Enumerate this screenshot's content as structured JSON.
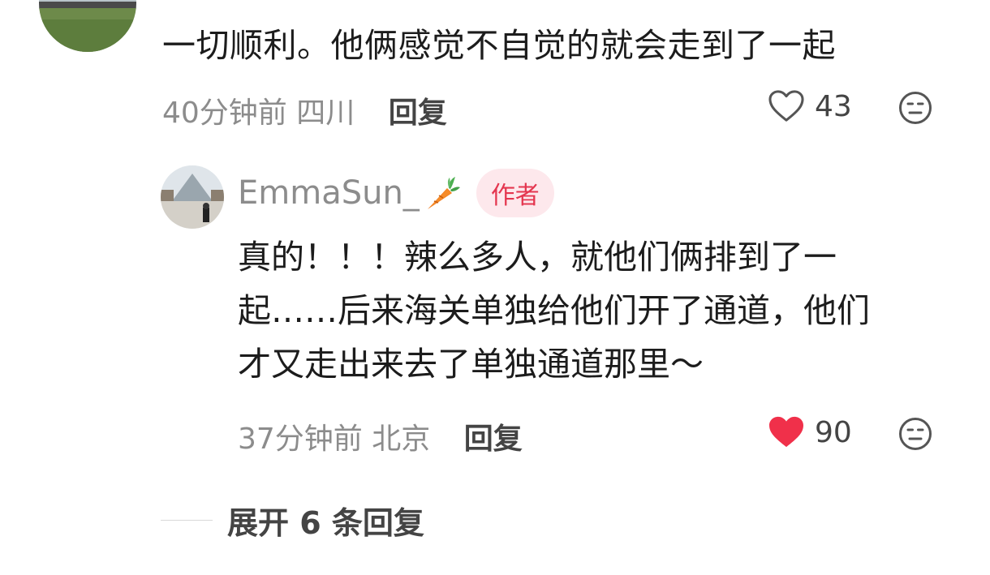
{
  "top_comment": {
    "text": "一切顺利。他俩感觉不自觉的就会走到了一起",
    "time": "40分钟前",
    "location": "四川",
    "reply_label": "回复",
    "likes": "43",
    "liked": false
  },
  "reply": {
    "author": "EmmaSun_",
    "author_emoji": "carrot-icon",
    "badge": "作者",
    "text_lines": [
      "真的！！！辣么多人，就他们俩排到了一",
      "起……后来海关单独给他们开了通道，他们",
      "才又走出来去了单独通道那里～"
    ],
    "time": "37分钟前",
    "location": "北京",
    "reply_label": "回复",
    "likes": "90",
    "liked": true
  },
  "expand": {
    "label": "展开 6 条回复"
  },
  "colors": {
    "heart_liked": "#f0304a",
    "badge_bg": "#fde8ec",
    "badge_text": "#e4364f"
  }
}
